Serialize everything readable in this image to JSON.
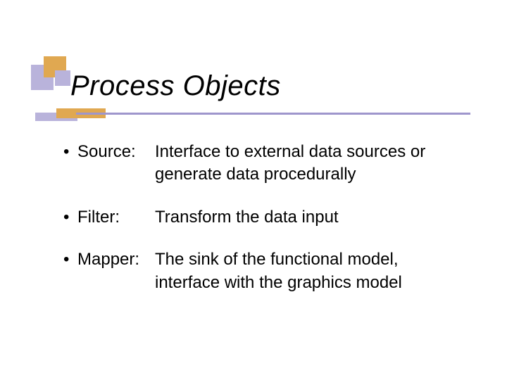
{
  "title": "Process Objects",
  "items": [
    {
      "term": "Source:",
      "desc": "Interface to external data sources or generate data procedurally"
    },
    {
      "term": "Filter:",
      "desc": "Transform the data input"
    },
    {
      "term": "Mapper:",
      "desc": "The sink of the functional model, interface with the graphics model"
    }
  ],
  "bullet_glyph": "•"
}
